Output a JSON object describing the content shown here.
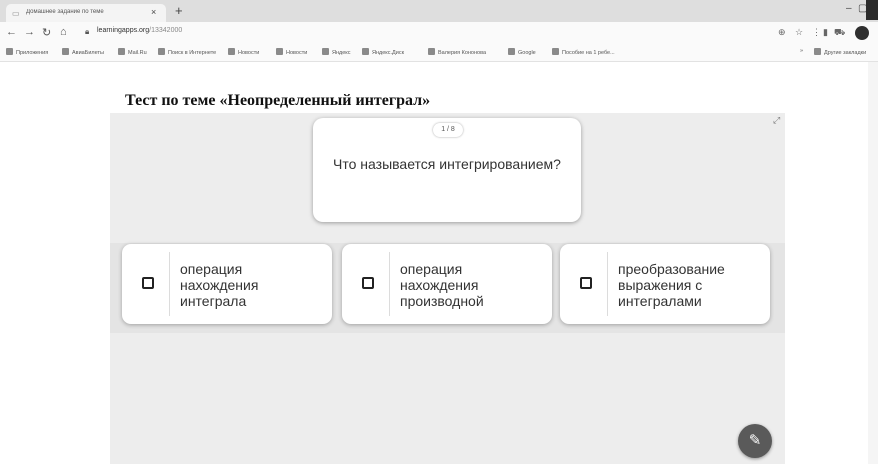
{
  "browser": {
    "tab_title": "Домашнее задание по теме",
    "tab_close": "×",
    "new_tab": "+",
    "url_host": "learningapps.org",
    "url_path": "/13342000",
    "bookmarks": [
      "Приложения",
      "АвиаБилеты",
      "Mail.Ru",
      "Поиск в Интернете",
      "Новости",
      "Новости",
      "Яндекс",
      "Яндекс.Диск",
      "Валерия Кононова",
      "Google",
      "Пособие на 1 ребе...",
      "»",
      "Другие закладки"
    ]
  },
  "page": {
    "title": "Тест по теме «Неопределенный интеграл»"
  },
  "game": {
    "counter": "1 / 8",
    "question": "Что называется интегрированием?",
    "answers": [
      {
        "label": "операция\nнахождения\nинтеграла"
      },
      {
        "label": "операция\nнахождения\nпроизводной"
      },
      {
        "label": "преобразование\nвыражения с\nинтегралами"
      }
    ]
  },
  "colors": {
    "game_background": "#ededed",
    "card": "#ffffff",
    "check_button": "#5a5a5a"
  }
}
